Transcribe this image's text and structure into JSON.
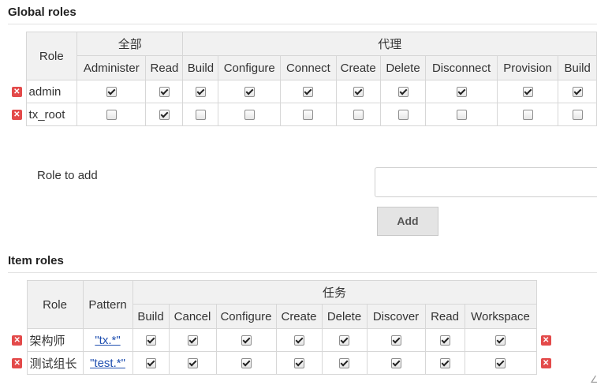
{
  "global_section": {
    "title": "Global roles",
    "role_header": "Role",
    "groups": [
      "全部",
      "代理"
    ],
    "permissions": [
      "Administer",
      "Read",
      "Build",
      "Configure",
      "Connect",
      "Create",
      "Delete",
      "Disconnect",
      "Provision",
      "Build"
    ],
    "rows": [
      {
        "name": "admin",
        "checks": [
          true,
          true,
          true,
          true,
          true,
          true,
          true,
          true,
          true,
          true
        ]
      },
      {
        "name": "tx_root",
        "checks": [
          false,
          true,
          false,
          false,
          false,
          false,
          false,
          false,
          false,
          false
        ]
      }
    ]
  },
  "add_role": {
    "label": "Role to add",
    "input_value": "",
    "button_label": "Add"
  },
  "item_section": {
    "title": "Item roles",
    "role_header": "Role",
    "pattern_header": "Pattern",
    "group": "任务",
    "permissions": [
      "Build",
      "Cancel",
      "Configure",
      "Create",
      "Delete",
      "Discover",
      "Read",
      "Workspace"
    ],
    "rows": [
      {
        "name": "架构师",
        "pattern": "\"tx.*\"",
        "checks": [
          true,
          true,
          true,
          true,
          true,
          true,
          true,
          true
        ]
      },
      {
        "name": "测试组长",
        "pattern": "\"test.*\"",
        "checks": [
          true,
          true,
          true,
          true,
          true,
          true,
          true,
          true
        ]
      }
    ]
  },
  "corner_text": "∠",
  "icons": {
    "delete": "delete-icon",
    "checkbox": "checkbox"
  },
  "colors": {
    "delete_red": "#e34a4a",
    "link_blue": "#1f4fb0",
    "header_bg": "#f1f1f1"
  }
}
